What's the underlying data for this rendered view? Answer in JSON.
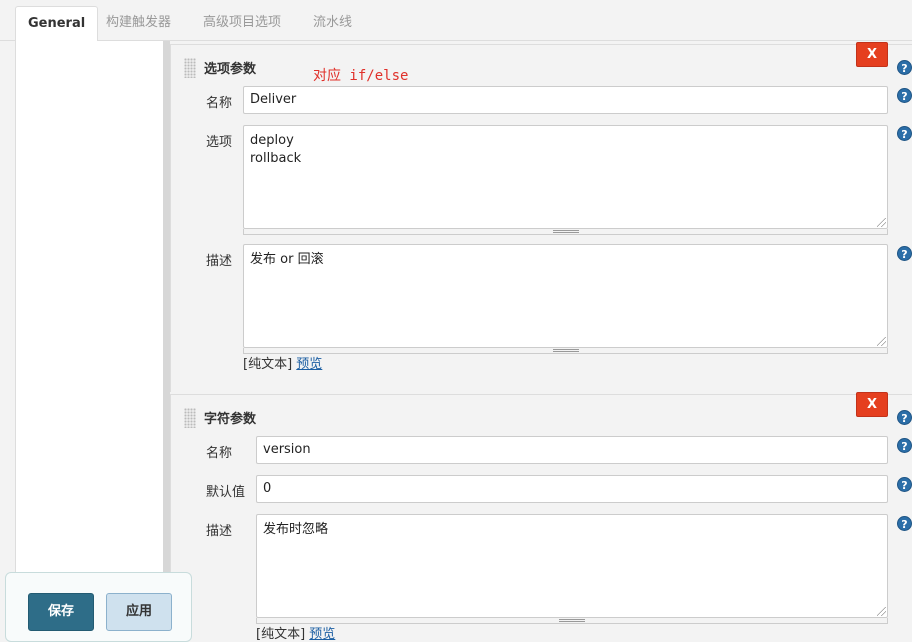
{
  "tabs": [
    {
      "label": "General"
    },
    {
      "label": "构建触发器"
    },
    {
      "label": "高级项目选项"
    },
    {
      "label": "流水线"
    }
  ],
  "choice_param": {
    "title": "选项参数",
    "annotation": "对应 if/else",
    "delete_label": "X",
    "name_label": "名称",
    "name_value": "Deliver",
    "choices_label": "选项",
    "choices_value": "deploy\nrollback",
    "desc_label": "描述",
    "desc_value": "发布 or 回滚",
    "plain_text": "[纯文本]",
    "preview_link": "预览"
  },
  "string_param": {
    "title": "字符参数",
    "delete_label": "X",
    "name_label": "名称",
    "name_value": "version",
    "default_label": "默认值",
    "default_value": "0",
    "desc_label": "描述",
    "desc_value": "发布时忽略",
    "plain_text": "[纯文本]",
    "preview_link": "预览"
  },
  "actions": {
    "save_label": "保存",
    "apply_label": "应用"
  },
  "help_glyph": "?",
  "colors": {
    "delete_button": "#e53f1f",
    "save_button": "#2e6d88",
    "apply_button": "#cfe1ee",
    "help_icon": "#2b6ea8",
    "annotation": "#e0302a",
    "link": "#1c5fa3"
  }
}
